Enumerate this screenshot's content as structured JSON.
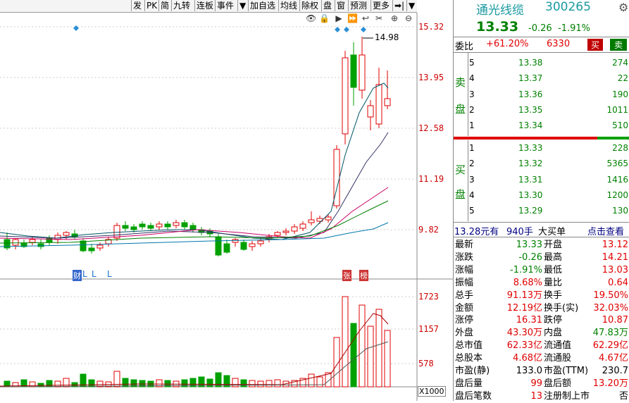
{
  "toolbar": {
    "buttons": [
      "发",
      "PK",
      "简",
      "九转",
      "连板",
      "事件",
      "▼",
      "加自选",
      "均线",
      "除权",
      "盘",
      "窗",
      "预测",
      "更多",
      "➡|",
      "▼"
    ]
  },
  "chart": {
    "price_ticks": [
      "15.32",
      "13.95",
      "12.58",
      "11.19",
      "9.82"
    ],
    "vol_ticks": [
      "1723",
      "1157",
      "578"
    ],
    "vol_unit": "X1000",
    "high_label": "14.98",
    "markers": [
      "财",
      "L",
      "L",
      "L",
      "张",
      "榜"
    ]
  },
  "stock": {
    "name": "通光线缆",
    "code": "300265",
    "price": "13.33",
    "change": "-0.26",
    "change_pct": "-1.91%"
  },
  "weibi": {
    "label": "委比",
    "value": "+61.20%",
    "diff": "6330",
    "buy_btn": "买",
    "sell_btn": "卖"
  },
  "sell_side_label": [
    "卖",
    "盘"
  ],
  "buy_side_label": [
    "买",
    "盘"
  ],
  "asks": [
    {
      "level": "5",
      "price": "13.38",
      "vol": "274"
    },
    {
      "level": "4",
      "price": "13.37",
      "vol": "22"
    },
    {
      "level": "3",
      "price": "13.36",
      "vol": "190"
    },
    {
      "level": "2",
      "price": "13.35",
      "vol": "1011"
    },
    {
      "level": "1",
      "price": "13.34",
      "vol": "510"
    }
  ],
  "bids": [
    {
      "level": "1",
      "price": "13.33",
      "vol": "228"
    },
    {
      "level": "2",
      "price": "13.32",
      "vol": "5365"
    },
    {
      "level": "3",
      "price": "13.31",
      "vol": "1416"
    },
    {
      "level": "4",
      "price": "13.30",
      "vol": "1200"
    },
    {
      "level": "5",
      "price": "13.29",
      "vol": "130"
    }
  ],
  "big_order": {
    "amount": "13.28元有",
    "hands": "940手",
    "label": "大买单",
    "link": "点击查看"
  },
  "stats": [
    {
      "l1": "最新",
      "v1": "13.33",
      "c1": "grn",
      "l2": "开盘",
      "v2": "13.12",
      "c2": "red"
    },
    {
      "l1": "涨跌",
      "v1": "-0.26",
      "c1": "grn",
      "l2": "最高",
      "v2": "14.21",
      "c2": "red"
    },
    {
      "l1": "涨幅",
      "v1": "-1.91%",
      "c1": "grn",
      "l2": "最低",
      "v2": "13.03",
      "c2": "red"
    },
    {
      "l1": "振幅",
      "v1": "8.68%",
      "c1": "red",
      "l2": "量比",
      "v2": "0.64",
      "c2": "red"
    },
    {
      "l1": "总手",
      "v1": "91.13万",
      "c1": "red",
      "l2": "换手",
      "v2": "19.50%",
      "c2": "red"
    },
    {
      "l1": "金额",
      "v1": "12.19亿",
      "c1": "red",
      "l2": "换手(实)",
      "v2": "32.03%",
      "c2": "red"
    },
    {
      "l1": "涨停",
      "v1": "16.31",
      "c1": "red",
      "l2": "跌停",
      "v2": "10.87",
      "c2": "red"
    },
    {
      "l1": "外盘",
      "v1": "43.30万",
      "c1": "red",
      "l2": "内盘",
      "v2": "47.83万",
      "c2": "grn"
    },
    {
      "l1": "总市值",
      "v1": "62.33亿",
      "c1": "red",
      "l2": "流通值",
      "v2": "62.29亿",
      "c2": "red"
    },
    {
      "l1": "总股本",
      "v1": "4.68亿",
      "c1": "red",
      "l2": "流通股",
      "v2": "4.67亿",
      "c2": "red"
    },
    {
      "l1": "市盈(静)",
      "v1": "133.0",
      "c1": "blk",
      "l2": "市盈(TTM)",
      "v2": "230.7",
      "c2": "blk"
    },
    {
      "l1": "盘后量",
      "v1": "99",
      "c1": "red",
      "l2": "盘后额",
      "v2": "13.20万",
      "c2": "red"
    },
    {
      "l1": "盘后笔数",
      "v1": "13",
      "c1": "red",
      "l2": "注册制上市",
      "v2": "否",
      "c2": "blk"
    }
  ],
  "colors": {
    "up": "#e00000",
    "down": "#00a000",
    "ma5": "#005566",
    "ma10": "#cc0066",
    "ma20": "#c0c000",
    "ma30": "#008000",
    "ma60": "#0077aa"
  }
}
